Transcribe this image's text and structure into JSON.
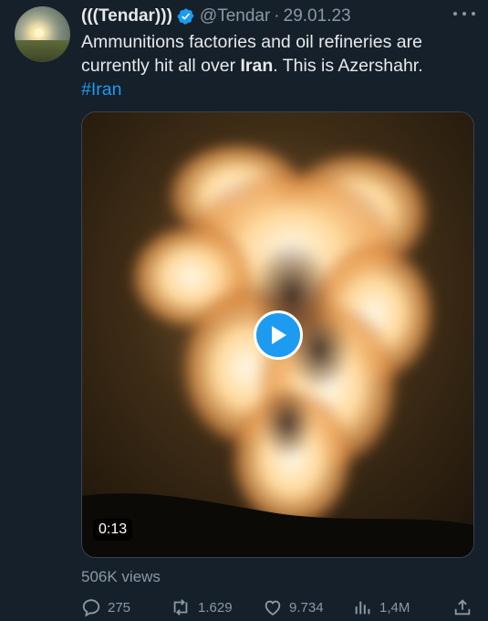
{
  "tweet": {
    "display_name": "(((Tendar)))",
    "handle": "@Tendar",
    "separator": "·",
    "date": "29.01.23",
    "text": {
      "part1": "Ammunitions factories and oil refineries are currently hit all over ",
      "bold": "Iran",
      "part2": ". This is Azershahr.",
      "hashtag": "#Iran"
    },
    "video": {
      "duration": "0:13"
    },
    "views": "506K views",
    "actions": {
      "replies": "275",
      "retweets": "1.629",
      "likes": "9.734",
      "analytics": "1,4M"
    }
  },
  "colors": {
    "background": "#15202b",
    "accent": "#1d9bf0",
    "secondary_text": "#8b98a5"
  },
  "icons": [
    "verified-badge-icon",
    "more-options-icon",
    "play-icon",
    "reply-icon",
    "retweet-icon",
    "like-icon",
    "analytics-icon",
    "share-icon"
  ]
}
